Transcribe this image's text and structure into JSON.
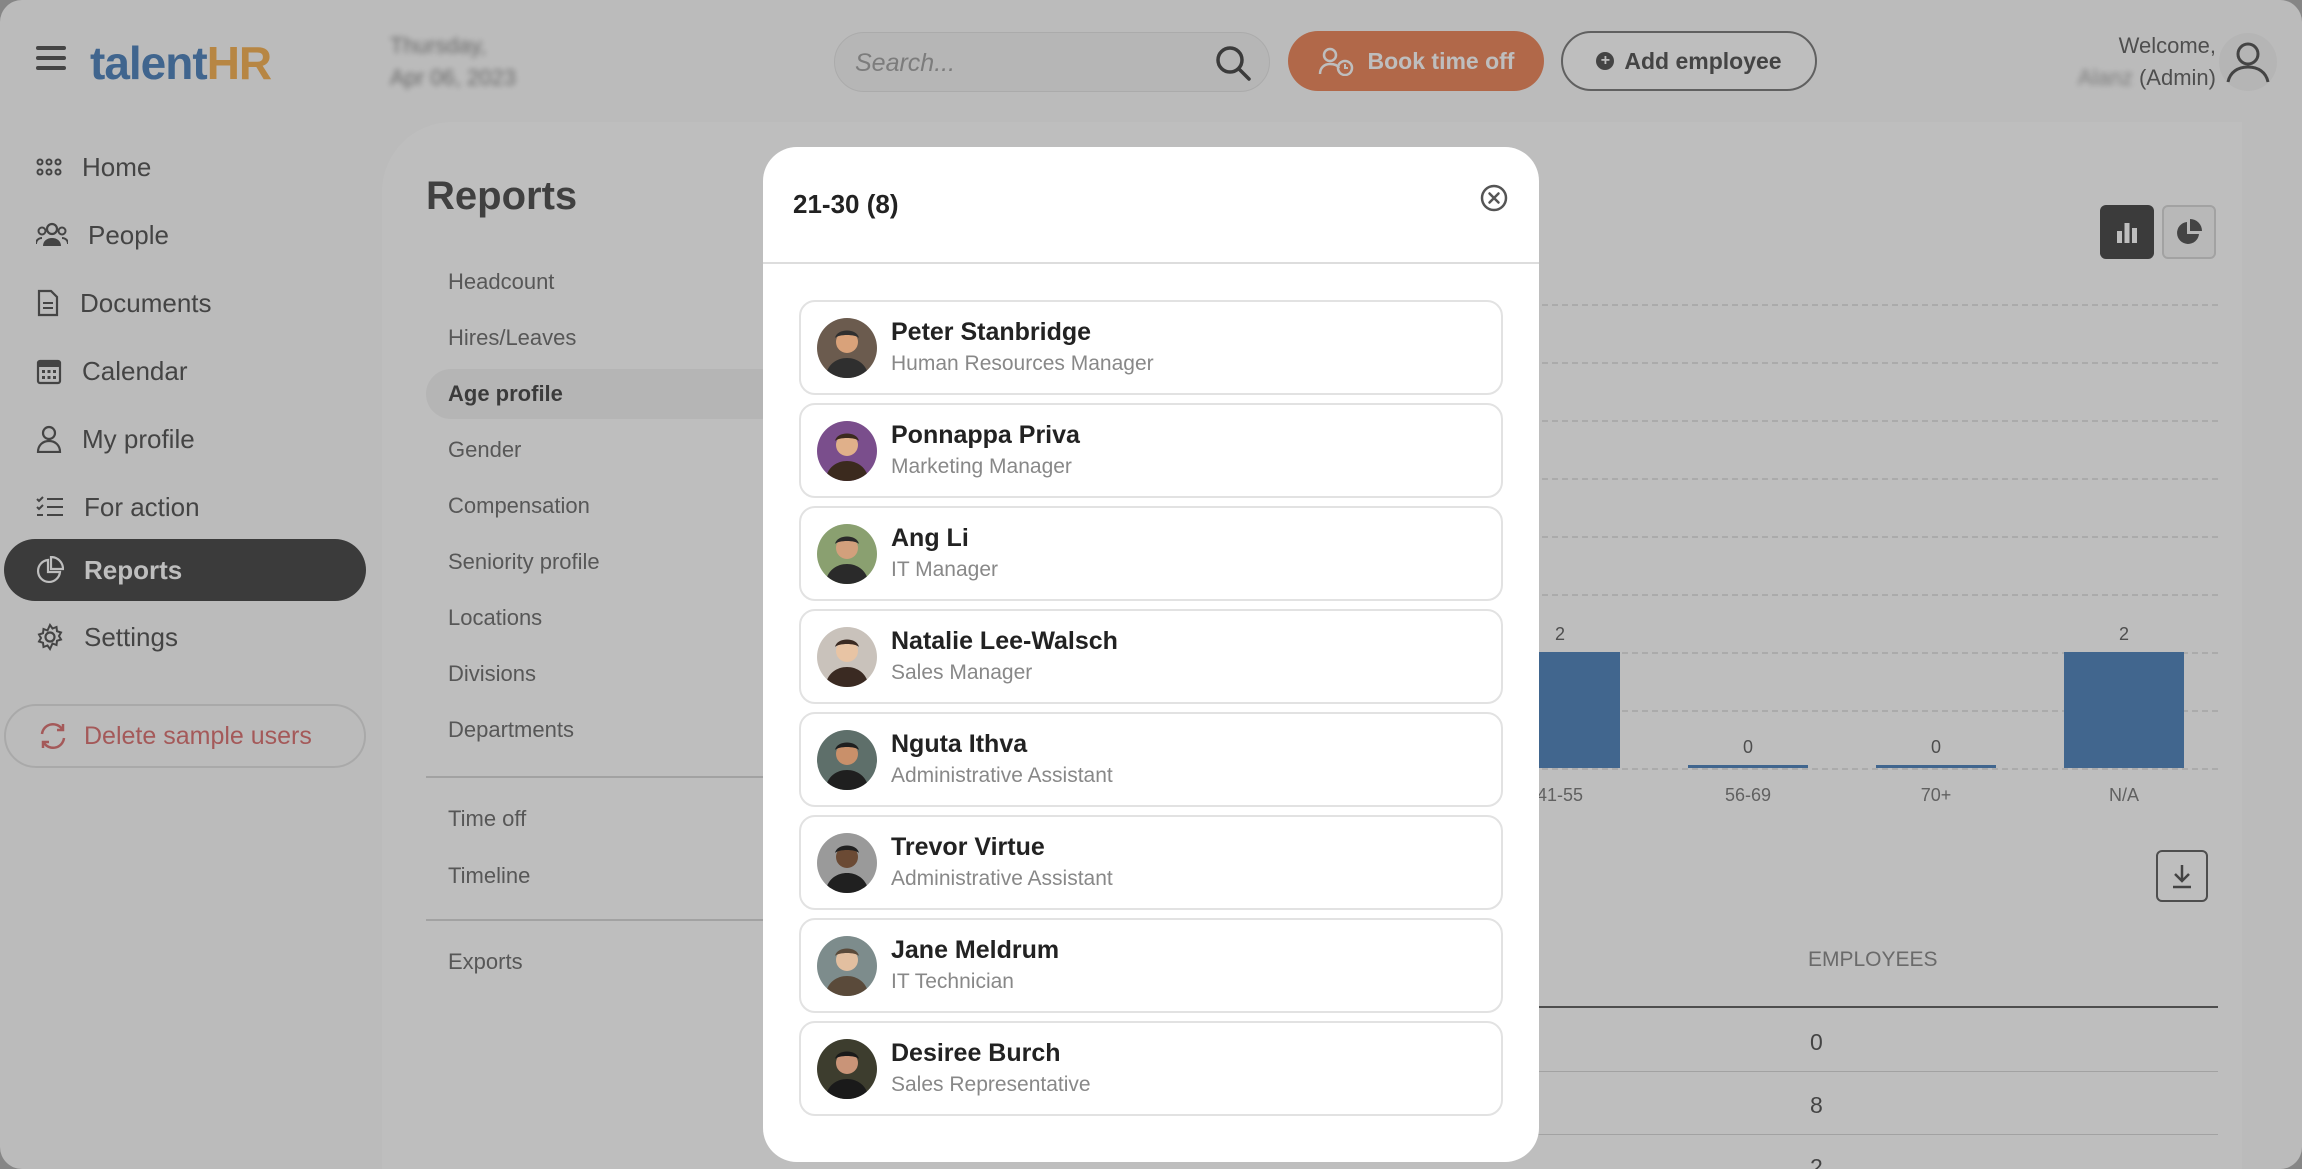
{
  "header": {
    "logo_part1": "talent",
    "logo_part2": "HR",
    "date_line1": "Thursday,",
    "date_line2": "Apr 06, 2023",
    "search_placeholder": "Search...",
    "book_time_off": "Book time off",
    "add_employee": "Add employee",
    "welcome": "Welcome,",
    "user_name": "Alanz",
    "user_role": "(Admin)"
  },
  "sidebar": {
    "items": [
      {
        "label": "Home",
        "icon": "grid-icon"
      },
      {
        "label": "People",
        "icon": "people-icon"
      },
      {
        "label": "Documents",
        "icon": "document-icon"
      },
      {
        "label": "Calendar",
        "icon": "calendar-icon"
      },
      {
        "label": "My profile",
        "icon": "user-icon"
      },
      {
        "label": "For action",
        "icon": "checklist-icon"
      },
      {
        "label": "Reports",
        "icon": "pie-chart-icon",
        "active": true
      },
      {
        "label": "Settings",
        "icon": "gear-icon"
      }
    ],
    "delete_sample_users": "Delete sample users"
  },
  "reports": {
    "title": "Reports",
    "items": [
      "Headcount",
      "Hires/Leaves",
      "Age profile",
      "Gender",
      "Compensation",
      "Seniority profile",
      "Locations",
      "Divisions",
      "Departments"
    ],
    "items2": [
      "Time off",
      "Timeline"
    ],
    "items3": [
      "Exports"
    ],
    "active": "Age profile"
  },
  "chart_data": {
    "type": "bar",
    "categories": [
      "41-55",
      "56-69",
      "70+",
      "N/A"
    ],
    "values": [
      2,
      0,
      0,
      2
    ],
    "ylim": [
      0,
      8
    ]
  },
  "table": {
    "header": "EMPLOYEES",
    "values": [
      "0",
      "8",
      "2"
    ]
  },
  "modal": {
    "title": "21-30 (8)",
    "employees": [
      {
        "name": "Peter Stanbridge",
        "role": "Human Resources Manager"
      },
      {
        "name": "Ponnappa Priva",
        "role": "Marketing Manager"
      },
      {
        "name": "Ang Li",
        "role": "IT Manager"
      },
      {
        "name": "Natalie Lee-Walsch",
        "role": "Sales Manager"
      },
      {
        "name": "Nguta Ithva",
        "role": "Administrative Assistant"
      },
      {
        "name": "Trevor Virtue",
        "role": "Administrative Assistant"
      },
      {
        "name": "Jane Meldrum",
        "role": "IT Technician"
      },
      {
        "name": "Desiree Burch",
        "role": "Sales Representative"
      }
    ]
  },
  "colors": {
    "accent_orange": "#e8632b",
    "brand_blue": "#1a5da8",
    "brand_orange": "#f39a1f",
    "bar_blue": "#1d5fa8",
    "danger": "#d04848"
  }
}
